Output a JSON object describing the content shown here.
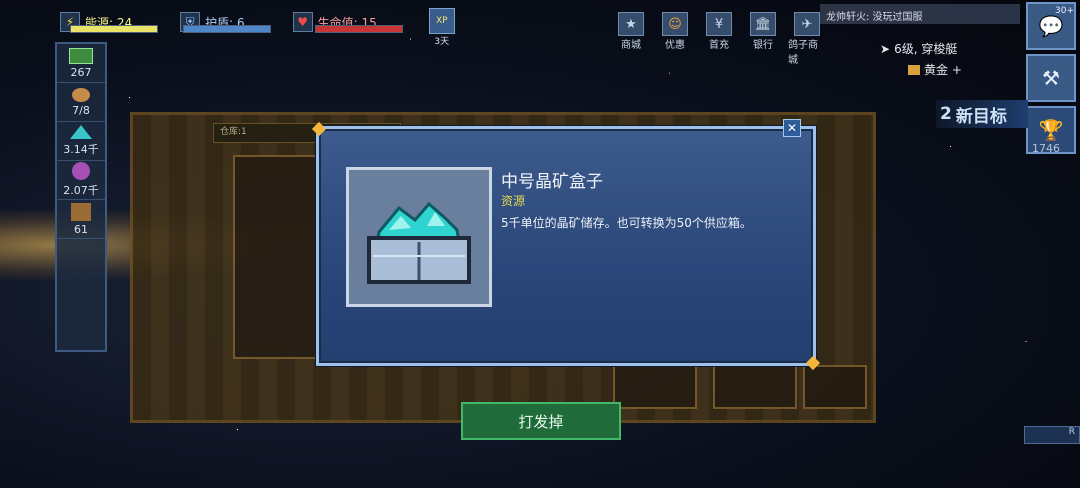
{
  "topbar": {
    "energy_label": "能源: 24",
    "shield_label": "护盾: 6",
    "hp_label": "生命值: 15",
    "xp_badge": "XP",
    "xp_days": "3天"
  },
  "resources": [
    {
      "name": "money",
      "value": "267"
    },
    {
      "name": "crew",
      "value": "7/8"
    },
    {
      "name": "crystal",
      "value": "3.14千"
    },
    {
      "name": "gas",
      "value": "2.07千"
    },
    {
      "name": "supply",
      "value": "61"
    }
  ],
  "nav": [
    {
      "icon": "star-icon",
      "label": "商城",
      "glyph": "★"
    },
    {
      "icon": "smile-icon",
      "label": "优惠",
      "glyph": "☺"
    },
    {
      "icon": "yen-icon",
      "label": "首充",
      "glyph": "¥"
    },
    {
      "icon": "bank-icon",
      "label": "银行",
      "glyph": "🏛"
    },
    {
      "icon": "pigeon-icon",
      "label": "鸽子商城",
      "glyph": "✈"
    }
  ],
  "chat": {
    "text": "龙帅轩火: 没玩过国服"
  },
  "mission": {
    "rank": "6级, 穿梭艇",
    "gold": "黄金 +"
  },
  "new_goals": {
    "count": "2",
    "label": "新目标"
  },
  "trophy": {
    "count": "1746"
  },
  "chat_badge": "30+",
  "ship_storage_label": "仓库:1",
  "dialog": {
    "title": "中号晶矿盒子",
    "category": "资源",
    "description": "5千单位的晶矿储存。也可转换为50个供应箱。"
  },
  "discard_button": "打发掉",
  "colors": {
    "accent": "#f2b73b",
    "dialog_bg": "#2a467a",
    "discard_bg": "#1f6c3a",
    "category": "#e6d84b"
  }
}
